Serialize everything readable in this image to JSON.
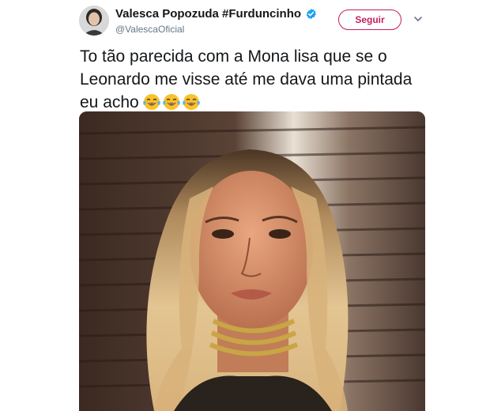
{
  "tweet": {
    "display_name": "Valesca Popozuda #Furduncinho",
    "handle": "@ValescaOficial",
    "verified": true,
    "follow_label": "Seguir",
    "text_lines": [
      "To tão parecida com a Mona lisa que se o",
      "Leonardo me visse até me dava uma pintada",
      "eu acho"
    ],
    "emojis": [
      "face-with-tears-of-joy",
      "face-with-tears-of-joy",
      "face-with-tears-of-joy"
    ],
    "colors": {
      "follow_accent": "#c41e5a",
      "verified": "#1da1f2",
      "handle": "#657786"
    }
  }
}
